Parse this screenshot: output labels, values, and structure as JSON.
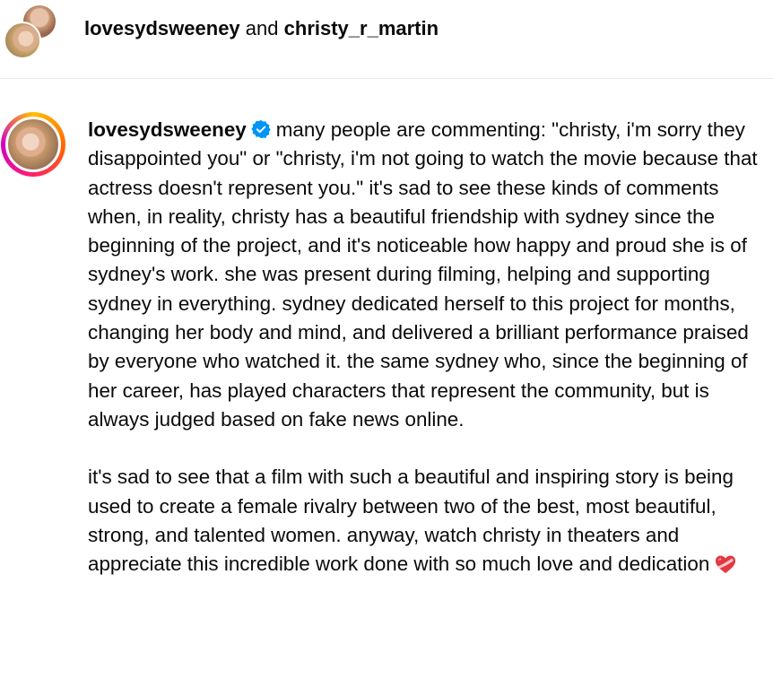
{
  "header": {
    "user1": "lovesydsweeney",
    "conjunction": "and",
    "user2": "christy_r_martin"
  },
  "post": {
    "username": "lovesydsweeney",
    "verified_icon": "verified-badge-icon",
    "paragraph1": "many people are commenting: \"christy, i'm sorry they disappointed you\" or \"christy, i'm not going to watch the movie because that actress doesn't represent you.\" it's sad to see these kinds of comments when, in reality, christy has a beautiful friendship with sydney since the beginning of the project, and it's noticeable how happy and proud she is of sydney's work. she was present during filming, helping and supporting sydney in everything. sydney dedicated herself to this project for months, changing her body and mind, and delivered a brilliant performance praised by everyone who watched it. the same sydney who, since the beginning of her career, has played characters that represent the community, but is always judged based on fake news online.",
    "paragraph2": "it's sad to see that a film with such a beautiful and inspiring story is being used to create a female rivalry between two of the best, most beautiful, strong, and talented women. anyway, watch christy in theaters and appreciate this incredible work done with so much love and dedication",
    "end_icon": "heart-with-ribbon-icon"
  },
  "colors": {
    "verified_blue": "#0095f6",
    "text": "#0a0a0a",
    "divider": "#e9e9e9"
  }
}
